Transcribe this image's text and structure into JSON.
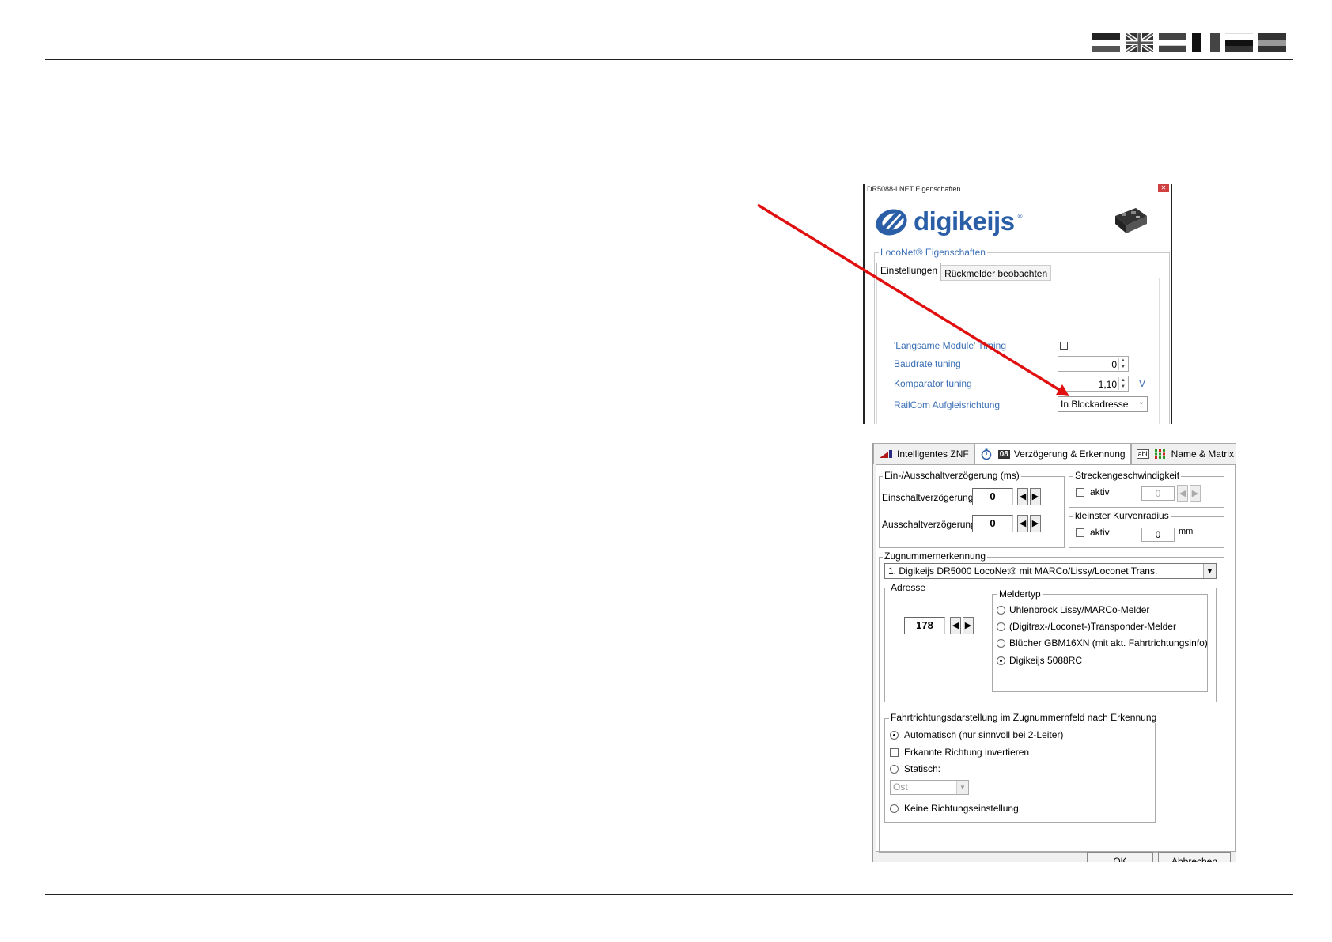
{
  "colors": {
    "accent_blue": "#3a6fb5",
    "logo_blue": "#2a5fa8",
    "arrow_red": "#e01010"
  },
  "flags": [
    "flag-de",
    "flag-uk",
    "flag-be",
    "flag-nl",
    "flag-gr",
    "flag-fr"
  ],
  "dialog1": {
    "title": "DR5088-LNET Eigenschaften",
    "logo": "digikeijs",
    "group_label": "LocoNet® Eigenschaften",
    "tabs": [
      "Einstellungen",
      "Rückmelder beobachten"
    ],
    "rows": {
      "slow_modules": {
        "label": "'Langsame Module' Timing"
      },
      "baudrate": {
        "label": "Baudrate tuning",
        "value": "0"
      },
      "comparator": {
        "label": "Komparator tuning",
        "value": "1,10",
        "unit": "V"
      },
      "railcom": {
        "label": "RailCom Aufgleisrichtung",
        "value": "In Blockadresse"
      }
    }
  },
  "dialog2": {
    "tabs": [
      "Intelligentes ZNF",
      "Verzögerung & Erkennung",
      "Name & Matrix"
    ],
    "tab_badge": "08",
    "tab_abl": "abl",
    "delay_group": {
      "legend": "Ein-/Ausschaltverzögerung (ms)",
      "on_label": "Einschaltverzögerung",
      "on_value": "0",
      "off_label": "Ausschaltverzögerung",
      "off_value": "0"
    },
    "speed_group": {
      "legend": "Streckengeschwindigkeit",
      "active_label": "aktiv",
      "value": "0"
    },
    "radius_group": {
      "legend": "kleinster Kurvenradius",
      "active_label": "aktiv",
      "value": "0",
      "unit": "mm"
    },
    "train_group": {
      "legend": "Zugnummernerkennung",
      "selected": "1. Digikeijs DR5000 LocoNet® mit MARCo/Lissy/Loconet Trans.",
      "address_legend": "Adresse",
      "address_value": "178",
      "type_legend": "Meldertyp",
      "types": [
        "Uhlenbrock Lissy/MARCo-Melder",
        "(Digitrax-/Loconet-)Transponder-Melder",
        "Blücher GBM16XN (mit akt. Fahrtrichtungsinfo)",
        "Digikeijs 5088RC"
      ]
    },
    "direction_group": {
      "legend": "Fahrtrichtungsdarstellung  im Zugnummernfeld nach Erkennung",
      "auto": "Automatisch (nur sinnvoll bei 2-Leiter)",
      "invert": "Erkannte Richtung invertieren",
      "static": "Statisch:",
      "static_value": "Ost",
      "none": "Keine Richtungseinstellung"
    },
    "ok": "OK",
    "cancel": "Abbrechen"
  }
}
